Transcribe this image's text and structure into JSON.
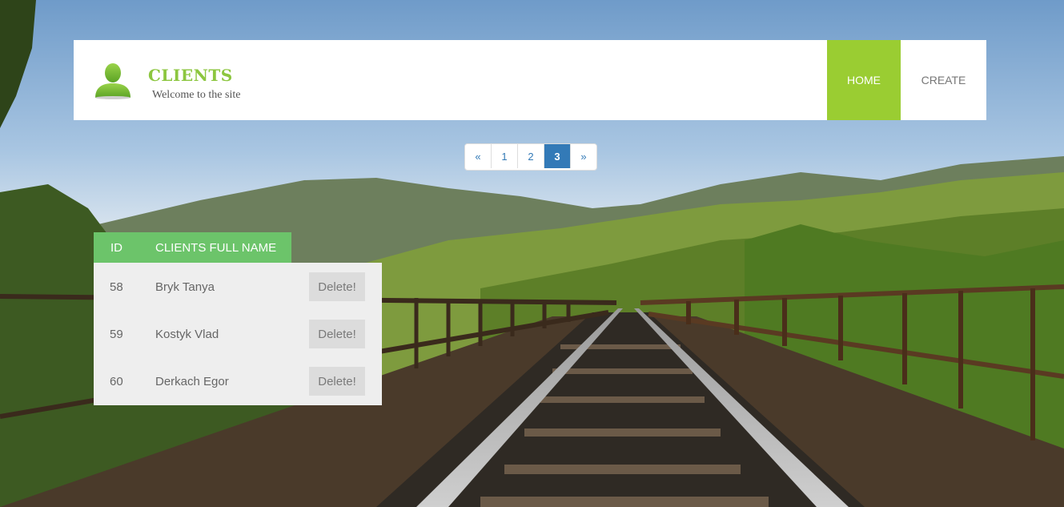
{
  "header": {
    "title": "CLIENTS",
    "subtitle": "Welcome to the site",
    "logo_icon": "user-silhouette-icon",
    "nav": [
      {
        "label": "HOME",
        "active": true
      },
      {
        "label": "CREATE",
        "active": false
      }
    ],
    "accent_color": "#9acd32"
  },
  "pagination": {
    "prev": "«",
    "pages": [
      "1",
      "2",
      "3"
    ],
    "current": "3",
    "next": "»"
  },
  "table": {
    "columns": [
      "ID",
      "CLIENTS FULL NAME"
    ],
    "header_color": "#6cc46a",
    "rows": [
      {
        "id": "58",
        "name": "Bryk Tanya",
        "action": "Delete!"
      },
      {
        "id": "59",
        "name": "Kostyk Vlad",
        "action": "Delete!"
      },
      {
        "id": "60",
        "name": "Derkach Egor",
        "action": "Delete!"
      }
    ]
  }
}
